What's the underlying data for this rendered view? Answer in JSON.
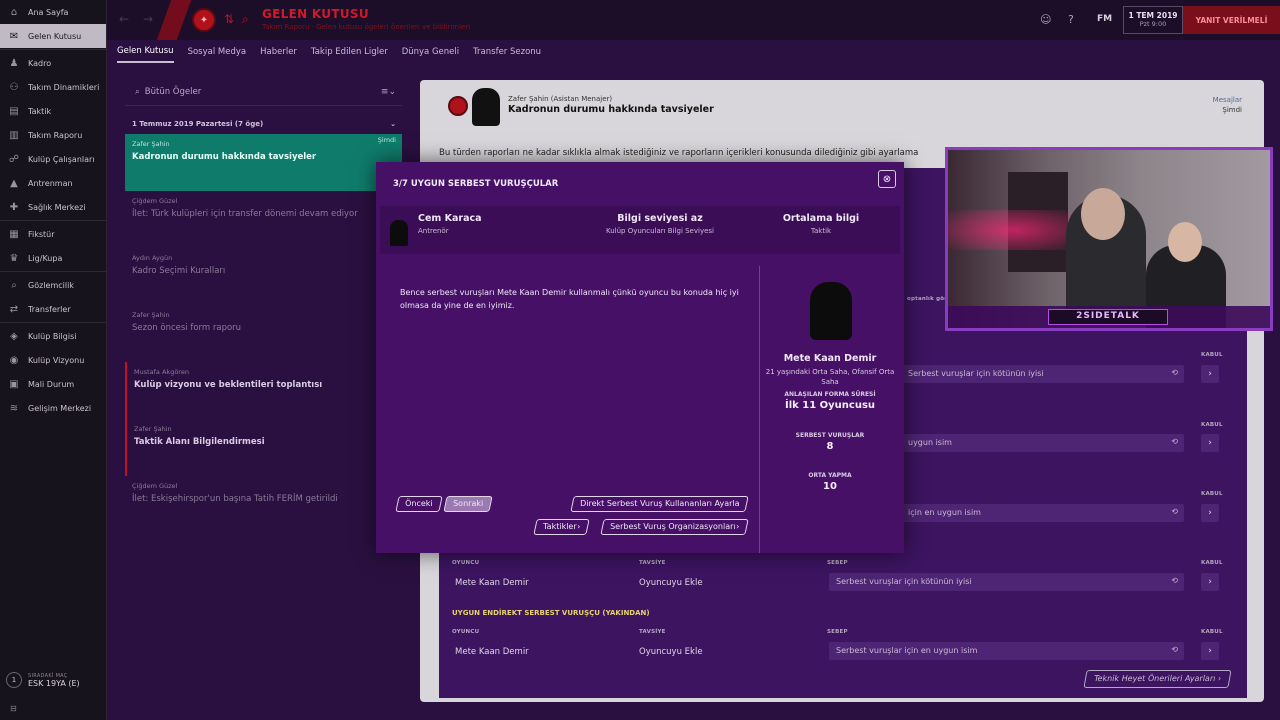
{
  "sidebar": {
    "items": [
      {
        "label": "Ana Sayfa",
        "icon": "home-icon"
      },
      {
        "label": "Gelen Kutusu",
        "icon": "inbox-icon",
        "active": true
      },
      {
        "label": "Kadro",
        "icon": "squad-icon"
      },
      {
        "label": "Takım Dinamikleri",
        "icon": "dynamics-icon"
      },
      {
        "label": "Taktik",
        "icon": "tactics-icon"
      },
      {
        "label": "Takım Raporu",
        "icon": "report-icon"
      },
      {
        "label": "Kulüp Çalışanları",
        "icon": "staff-icon"
      },
      {
        "label": "Antrenman",
        "icon": "training-icon"
      },
      {
        "label": "Sağlık Merkezi",
        "icon": "medical-icon"
      },
      {
        "label": "Fikstür",
        "icon": "calendar-icon"
      },
      {
        "label": "Lig/Kupa",
        "icon": "trophy-icon"
      },
      {
        "label": "Gözlemcilik",
        "icon": "scouting-icon"
      },
      {
        "label": "Transferler",
        "icon": "transfers-icon"
      },
      {
        "label": "Kulüp Bilgisi",
        "icon": "club-info-icon"
      },
      {
        "label": "Kulüp Vizyonu",
        "icon": "vision-icon"
      },
      {
        "label": "Mali Durum",
        "icon": "finance-icon"
      },
      {
        "label": "Gelişim Merkezi",
        "icon": "development-icon"
      }
    ],
    "next_match_label": "SIRADAKİ MAÇ",
    "next_match_num": "1",
    "next_match_value": "ESK 19YA (E)"
  },
  "topbar": {
    "title": "GELEN KUTUSU",
    "subtitle": "Takım Raporu · Gelen kutusu ögeleri önerileri ve bildirimleri",
    "fm_logo": "FM",
    "date": "1 TEM 2019",
    "day_time": "Pzt 9:00",
    "continue_label": "YANIT VERİLMELİ"
  },
  "tabs": [
    "Gelen Kutusu",
    "Sosyal Medya",
    "Haberler",
    "Takip Edilen Ligler",
    "Dünya Geneli",
    "Transfer Sezonu"
  ],
  "inbox": {
    "search_placeholder": "Bütün Ögeler",
    "group_header": "1 Temmuz 2019 Pazartesi (7 öge)",
    "messages": [
      {
        "from": "Zafer Şahin",
        "subject": "Kadronun durumu hakkında tavsiyeler",
        "time": "Şimdi"
      },
      {
        "from": "Çiğdem Güzel",
        "subject": "İlet: Türk kulüpleri için transfer dönemi devam ediyor"
      },
      {
        "from": "Aydın Aygün",
        "subject": "Kadro Seçimi Kuralları"
      },
      {
        "from": "Zafer Şahin",
        "subject": "Sezon öncesi form raporu"
      },
      {
        "from": "Mustafa Akgören",
        "subject": "Kulüp vizyonu ve beklentileri toplantısı"
      },
      {
        "from": "Zafer Şahin",
        "subject": "Taktik Alanı Bilgilendirmesi"
      },
      {
        "from": "Çiğdem Güzel",
        "subject": "İlet: Eskişehirspor'un başına Tatih  FERİM getirildi"
      }
    ]
  },
  "message": {
    "sender": "Zafer Şahin  (Asistan Menajer)",
    "title": "Kadronun durumu hakkında tavsiyeler",
    "category": "Mesajlar",
    "time": "Şimdi",
    "body": "Bu türden raporları ne kadar sıklıkla almak istediğiniz ve raporların içerikleri konusunda dilediğiniz gibi ayarlama",
    "partial_1": "optanlık gör",
    "rows": [
      {
        "player": "",
        "advice": "",
        "reason": "Serbest vuruşlar için kötünün iyisi"
      },
      {
        "player": "",
        "advice": "",
        "reason": "uygun isim"
      },
      {
        "player": "",
        "advice": "",
        "reason": "için en uygun isim"
      }
    ],
    "col_player": "OYUNCU",
    "col_advice": "TAVSİYE",
    "col_reason": "SEBEP",
    "col_accept": "KABUL",
    "section_indirect": "UYGUN ENDİREKT SERBEST VURUŞÇU (YAKINDAN)",
    "bottom_rows": [
      {
        "player": "Mete Kaan Demir",
        "advice": "Oyuncuyu Ekle",
        "reason": "Serbest vuruşlar için kötünün iyisi"
      },
      {
        "player": "Mete Kaan Demir",
        "advice": "Oyuncuyu Ekle",
        "reason": "Serbest vuruşlar için en uygun isim"
      }
    ],
    "staff_link": "Teknik Heyet Önerileri Ayarları"
  },
  "modal": {
    "title": "3/7  UYGUN SERBEST VURUŞÇULAR",
    "coach_name": "Cem Karaca",
    "coach_role": "Antrenör",
    "k1_title": "Bilgi seviyesi az",
    "k1_sub": "Kulüp Oyuncuları Bilgi Seviyesi",
    "k2_title": "Ortalama bilgi",
    "k2_sub": "Taktik",
    "text": "Bence serbest vuruşları Mete Kaan Demir kullanmalı çünkü oyuncu bu konuda hiç iyi olmasa da yine de en iyimiz.",
    "player_name": "Mete Kaan Demir",
    "player_desc": "21 yaşındaki Orta Saha, Ofansif Orta Saha",
    "contract_label": "ANLAŞILAN FORMA SÜRESİ",
    "contract_value": "İlk 11 Oyuncusu",
    "fk_label": "SERBEST VURUŞLAR",
    "fk_value": "8",
    "cross_label": "ORTA YAPMA",
    "cross_value": "10",
    "btn_prev": "Önceki",
    "btn_next": "Sonraki",
    "btn_direct": "Direkt Serbest Vuruş Kullananları Ayarla",
    "btn_tactics": "Taktikler",
    "btn_setpieces": "Serbest Vuruş Organizasyonları"
  },
  "webcam": {
    "label": "2SIDETALK"
  },
  "colors": {
    "accent": "#d01a2a",
    "selected": "#0f7c6b",
    "modal": "#461066",
    "webcam_frame": "#8a3cc0"
  }
}
